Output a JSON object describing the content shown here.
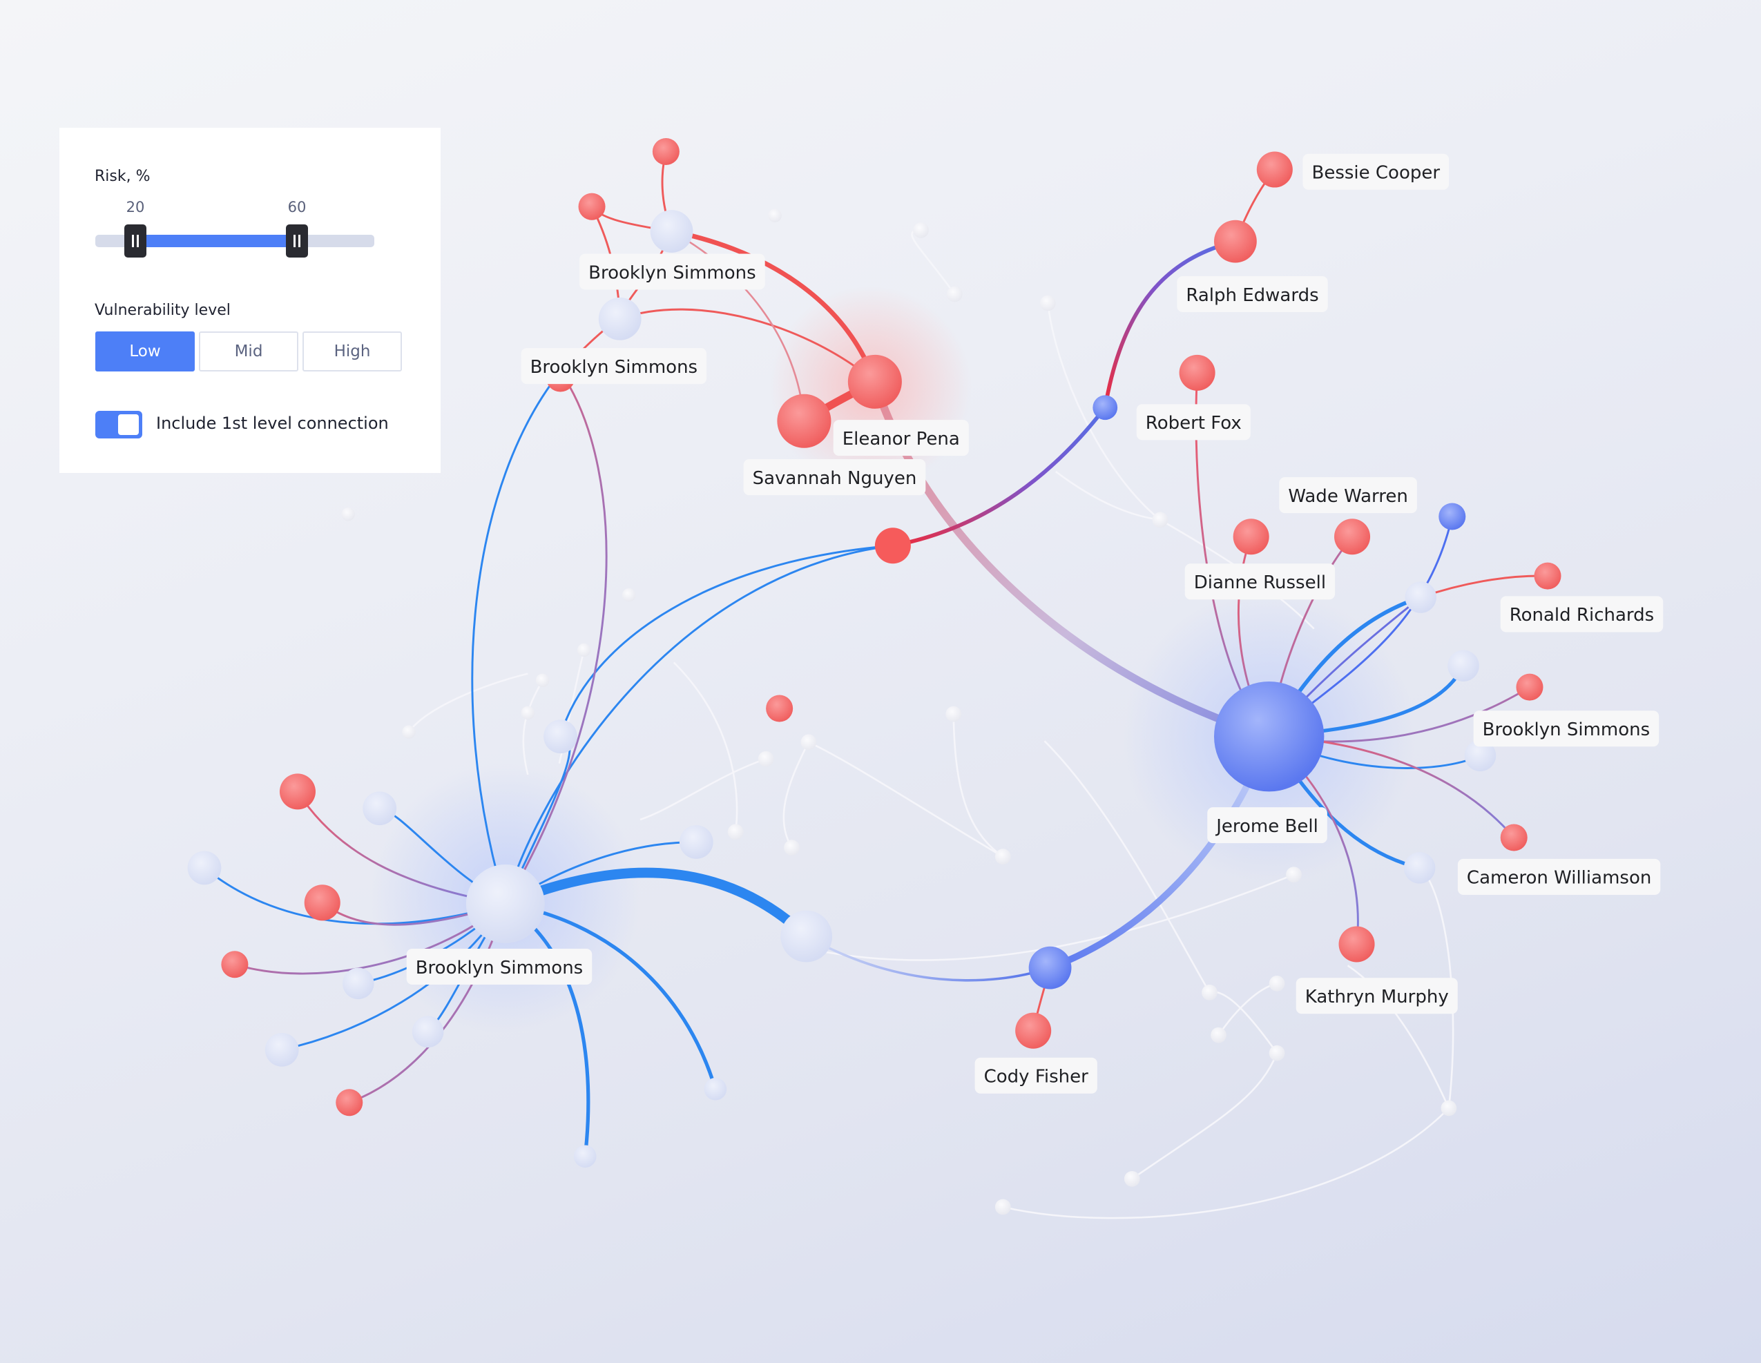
{
  "filters": {
    "risk": {
      "label": "Risk, %",
      "min_value": 20,
      "max_value": 60,
      "range_min": 0,
      "range_max": 100,
      "min_label": "20",
      "max_label": "60"
    },
    "vulnerability": {
      "label": "Vulnerability level",
      "options": [
        "Low",
        "Mid",
        "High"
      ],
      "selected": "Low"
    },
    "first_level_toggle": {
      "label": "Include 1st level connection",
      "on": true
    }
  },
  "colors": {
    "accent": "#4d7ff7",
    "risk_node": "#f26b6b",
    "hub_node": "#6f8cf3",
    "neutral_node": "#dde3f5",
    "edge_blue": "#2c86f0",
    "edge_red": "#ef5050",
    "label_bg": "#f7f7f8"
  },
  "people": {
    "bessie_cooper": "Bessie Cooper",
    "ralph_edwards": "Ralph Edwards",
    "robert_fox": "Robert Fox",
    "wade_warren": "Wade Warren",
    "dianne_russell": "Dianne Russell",
    "ronald_richards": "Ronald Richards",
    "brooklyn_simmons_right": "Brooklyn Simmons",
    "jerome_bell": "Jerome Bell",
    "cameron_williamson": "Cameron Williamson",
    "kathryn_murphy": "Kathryn Murphy",
    "cody_fisher": "Cody Fisher",
    "brooklyn_simmons_top": "Brooklyn Simmons",
    "brooklyn_simmons_mid": "Brooklyn Simmons",
    "eleanor_pena": "Eleanor Pena",
    "savannah_nguyen": "Savannah Nguyen",
    "brooklyn_simmons_bottom": "Brooklyn Simmons"
  }
}
